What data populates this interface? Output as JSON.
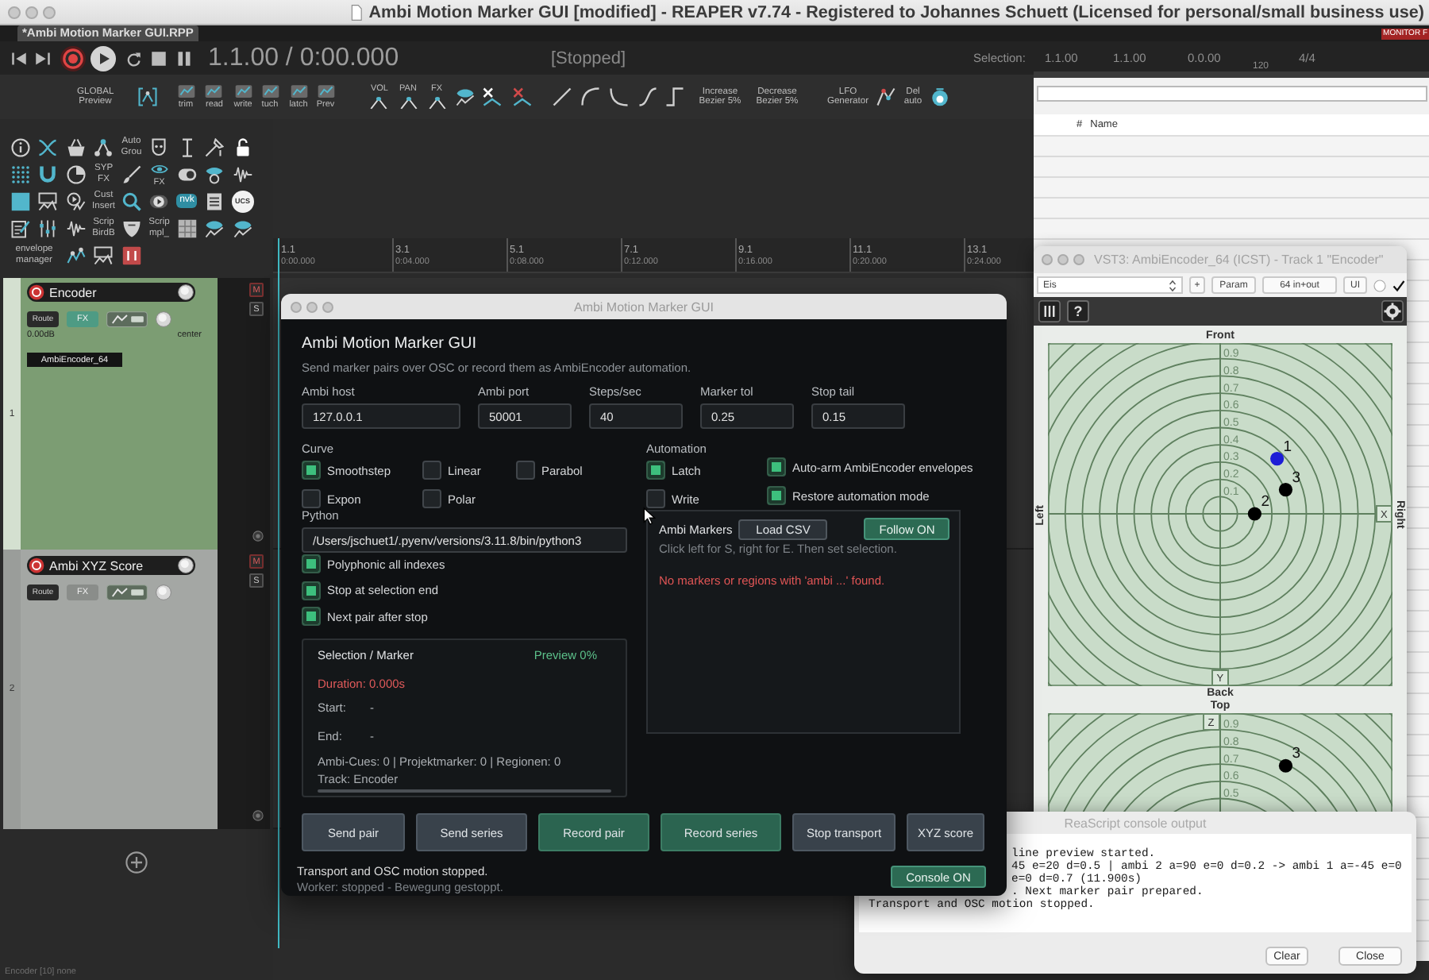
{
  "window": {
    "title": "Ambi Motion Marker GUI [modified] - REAPER v7.74 - Registered to Johannes Schuett (Licensed for personal/small business use)"
  },
  "project_tab": {
    "label": "*Ambi Motion Marker GUI.RPP",
    "selected": true
  },
  "monitor_badge": "MONITOR F",
  "transport": {
    "position": "1.1.00 / 0:00.000",
    "state": "[Stopped]",
    "selection_label": "Selection:",
    "selection_values": [
      "1.1.00",
      "1.1.00",
      "0.0.00"
    ],
    "tempo": "120",
    "time_signature": "4/4"
  },
  "toolbar": {
    "labels": [
      "GLOBAL Preview",
      "trim",
      "read",
      "write",
      "tuch",
      "latch",
      "Prev",
      "VOL",
      "PAN",
      "FX",
      "Increase Bezier 5%",
      "Decrease Bezier 5%",
      "LFO Generator",
      "Del auto"
    ]
  },
  "side_toolbar": {
    "labels": [
      "Auto Grou",
      "SYP FX",
      "FX",
      "Cust Insert",
      "nvk",
      "UCS",
      "Scrip BirdB",
      "Scrip mpl_",
      "envelope manager"
    ]
  },
  "tracks": [
    {
      "number": "1",
      "name": "Encoder",
      "color": "#7c9d73",
      "selected": true,
      "route": "Route",
      "fx": "FX",
      "fx_enabled": true,
      "volume": "0.00dB",
      "pan": "center",
      "fx_chain": [
        "AmbiEncoder_64"
      ],
      "mute": "M",
      "solo": "S"
    },
    {
      "number": "2",
      "name": "Ambi XYZ Score",
      "color": "#a4a7a4",
      "selected": false,
      "route": "Route",
      "fx": "FX",
      "fx_enabled": false,
      "mute": "M",
      "solo": "S"
    }
  ],
  "ruler": [
    {
      "bar": "1.1",
      "time": "0:00.000"
    },
    {
      "bar": "3.1",
      "time": "0:04.000"
    },
    {
      "bar": "5.1",
      "time": "0:08.000"
    },
    {
      "bar": "7.1",
      "time": "0:12.000"
    },
    {
      "bar": "9.1",
      "time": "0:16.000"
    },
    {
      "bar": "11.1",
      "time": "0:20.000"
    },
    {
      "bar": "13.1",
      "time": "0:24.000"
    }
  ],
  "status_bar": "Encoder [10] none",
  "region_manager": {
    "columns": [
      "#",
      "Name"
    ]
  },
  "plugin_window": {
    "title": "VST3: AmbiEncoder_64 (ICST) - Track 1 \"Encoder\"",
    "preset": "Eis",
    "buttons": [
      "+",
      "Param",
      "64 in+out",
      "UI"
    ],
    "enabled": true,
    "help": "?",
    "xy_view": {
      "front": "Front",
      "left": "Left",
      "right": "Right",
      "back": "Back",
      "handles": [
        "X",
        "Y"
      ],
      "scale": [
        "0.9",
        "0.8",
        "0.7",
        "0.6",
        "0.5",
        "0.4",
        "0.3",
        "0.2",
        "0.1"
      ],
      "sources": [
        {
          "label": "1",
          "color": "#1d1dd6"
        },
        {
          "label": "3",
          "color": "#000000"
        },
        {
          "label": "2",
          "color": "#000000"
        }
      ]
    },
    "z_view": {
      "title": "Top",
      "handles": [
        "Z"
      ],
      "scale": [
        "0.9",
        "0.8",
        "0.7",
        "0.6",
        "0.5"
      ],
      "sources": [
        {
          "label": "3",
          "color": "#000000"
        }
      ]
    }
  },
  "dialog": {
    "title": "Ambi Motion Marker GUI",
    "heading": "Ambi Motion Marker GUI",
    "subtitle": "Send marker pairs over OSC or record them as AmbiEncoder automation.",
    "fields": [
      {
        "label": "Ambi host",
        "value": "127.0.0.1"
      },
      {
        "label": "Ambi port",
        "value": "50001"
      },
      {
        "label": "Steps/sec",
        "value": "40"
      },
      {
        "label": "Marker tol",
        "value": "0.25"
      },
      {
        "label": "Stop tail",
        "value": "0.15"
      }
    ],
    "curve": {
      "label": "Curve",
      "options": [
        {
          "label": "Smoothstep",
          "selected": true
        },
        {
          "label": "Linear",
          "selected": false
        },
        {
          "label": "Parabol",
          "selected": false
        },
        {
          "label": "Expon",
          "selected": false
        },
        {
          "label": "Polar",
          "selected": false
        }
      ]
    },
    "automation": {
      "label": "Automation",
      "modes": [
        {
          "label": "Latch",
          "selected": true
        },
        {
          "label": "Write",
          "selected": false
        }
      ],
      "options": [
        {
          "label": "Auto-arm AmbiEncoder envelopes",
          "checked": true
        },
        {
          "label": "Restore automation mode",
          "checked": true
        }
      ]
    },
    "python": {
      "label": "Python",
      "value": "/Users/jschuet1/.pyenv/versions/3.11.8/bin/python3"
    },
    "options": [
      {
        "label": "Polyphonic all indexes",
        "checked": true
      },
      {
        "label": "Stop at selection end",
        "checked": true
      },
      {
        "label": "Next pair after stop",
        "checked": true
      }
    ],
    "selection_panel": {
      "title": "Selection / Marker",
      "preview": "Preview 0%",
      "duration": "Duration: 0.000s",
      "rows": [
        {
          "label": "Start:",
          "value": "-"
        },
        {
          "label": "End:",
          "value": "-"
        }
      ],
      "counts": "Ambi-Cues: 0 | Projektmarker: 0 | Regionen: 0",
      "track": "Track: Encoder"
    },
    "markers_panel": {
      "title": "Ambi Markers",
      "load_button": "Load CSV",
      "follow_button": {
        "label": "Follow ON",
        "on": true
      },
      "hint": "Click left for S, right for E. Then set selection.",
      "message": "No markers or regions with 'ambi ...' found."
    },
    "buttons": [
      {
        "label": "Send pair",
        "kind": "plain"
      },
      {
        "label": "Send series",
        "kind": "plain"
      },
      {
        "label": "Record pair",
        "kind": "record"
      },
      {
        "label": "Record series",
        "kind": "record"
      },
      {
        "label": "Stop transport",
        "kind": "plain"
      },
      {
        "label": "XYZ score",
        "kind": "plain"
      }
    ],
    "status": "Transport and OSC motion stopped.",
    "worker": "Worker: stopped - Bewegung gestoppt.",
    "console_button": {
      "label": "Console ON",
      "on": true
    }
  },
  "console": {
    "title": "ReaScript console output",
    "lines": [
      {
        "text": "line preview started.",
        "covered": true
      },
      {
        "text": "45 e=20 d=0.5 | ambi 2 a=90 e=0 d=0.2 -> ambi 1 a=-45 e=0",
        "covered": true
      },
      {
        "text": "e=0 d=0.7 (11.900s)",
        "covered": true
      },
      {
        "text": ". Next marker pair prepared.",
        "covered": true
      },
      {
        "text": "Transport and OSC motion stopped.",
        "covered": false
      }
    ],
    "buttons": [
      "Clear",
      "Close"
    ]
  }
}
